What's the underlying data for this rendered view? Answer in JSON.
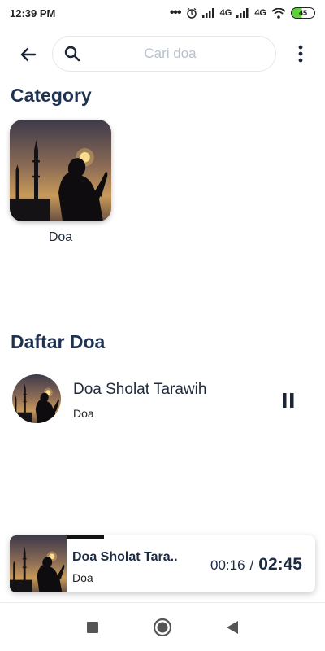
{
  "status_bar": {
    "time": "12:39 PM",
    "dots": "•••",
    "network1": "4G",
    "network2": "4G",
    "battery": "45",
    "icons": [
      "alarm-icon",
      "signal-icon",
      "wifi-icon",
      "battery-icon"
    ]
  },
  "header": {
    "search_placeholder": "Cari doa",
    "icons": [
      "arrow-left-icon",
      "search-icon",
      "more-vertical-icon"
    ]
  },
  "category": {
    "title": "Category",
    "items": [
      {
        "label": "Doa"
      }
    ]
  },
  "daftar": {
    "title": "Daftar Doa",
    "items": [
      {
        "title": "Doa Sholat Tarawih",
        "subtitle": "Doa",
        "action_icon": "pause-icon"
      }
    ]
  },
  "player": {
    "title": "Doa Sholat Tara..",
    "subtitle": "Doa",
    "current_time": "00:16",
    "separator": "/",
    "total_time": "02:45",
    "progress": 0.15
  },
  "nav": {
    "icons": [
      "recents-square-icon",
      "home-circle-icon",
      "back-triangle-icon"
    ]
  },
  "colors": {
    "title": "#1f3350",
    "accent": "#1c2b44",
    "battery_fill": "#5fd03a"
  }
}
